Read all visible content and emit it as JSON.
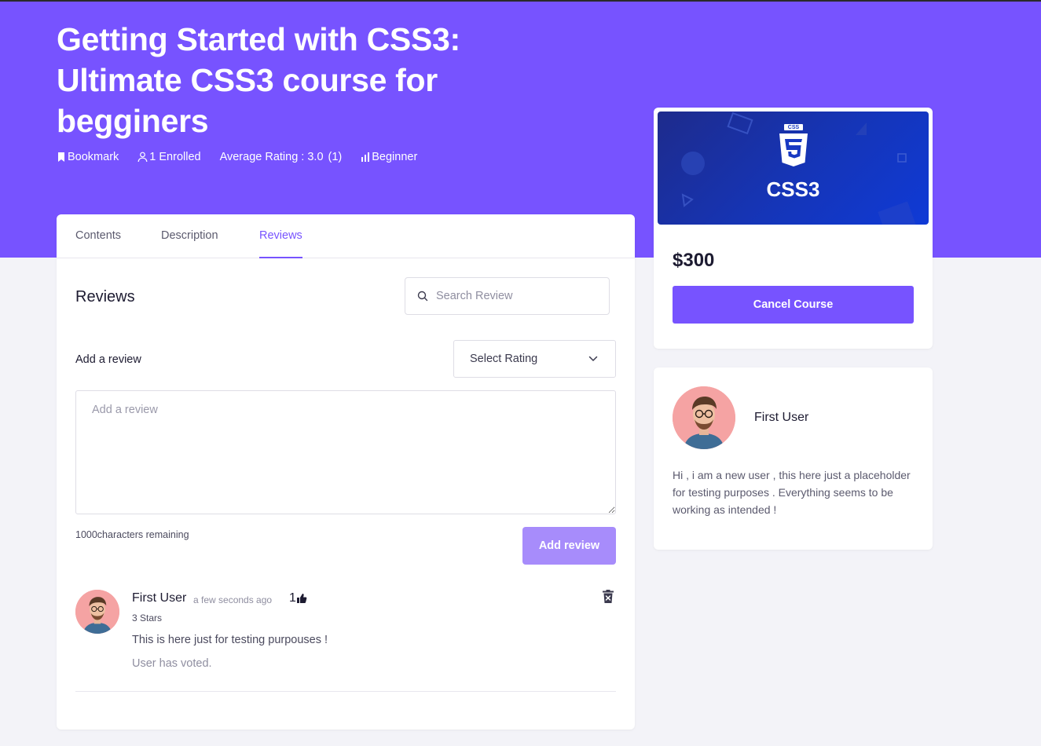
{
  "course": {
    "title": "Getting Started with CSS3: Ultimate CSS3 course for begginers",
    "bookmark_label": "Bookmark",
    "enrolled_label": "1 Enrolled",
    "average_rating_label": "Average Rating : 3.0",
    "rating_count": "(1)",
    "level_label": "Beginner"
  },
  "tabs": [
    {
      "label": "Contents"
    },
    {
      "label": "Description"
    },
    {
      "label": "Reviews",
      "active": true
    }
  ],
  "reviews_section": {
    "heading": "Reviews",
    "search_placeholder": "Search Review",
    "add_review_label": "Add a review",
    "select_rating_label": "Select Rating",
    "textarea_placeholder": "Add a review",
    "chars_remaining": "1000characters remaining",
    "add_review_button": "Add review"
  },
  "review": {
    "user": "First User",
    "time": "a few seconds ago",
    "likes": "1",
    "stars": "3 Stars",
    "text": "This is here just for testing purpouses !",
    "voted": "User has voted."
  },
  "sidebar": {
    "thumbnail_badge": "CSS",
    "thumbnail_label": "CSS3",
    "price": "$300",
    "cancel_button": "Cancel Course",
    "author_name": "First User",
    "author_bio": "Hi , i am a new user , this here just a placeholder for testing purposes . Everything seems to be working as intended !"
  },
  "colors": {
    "accent": "#7753ff",
    "accent_light": "#a78cfb",
    "background": "#f3f3f8"
  }
}
